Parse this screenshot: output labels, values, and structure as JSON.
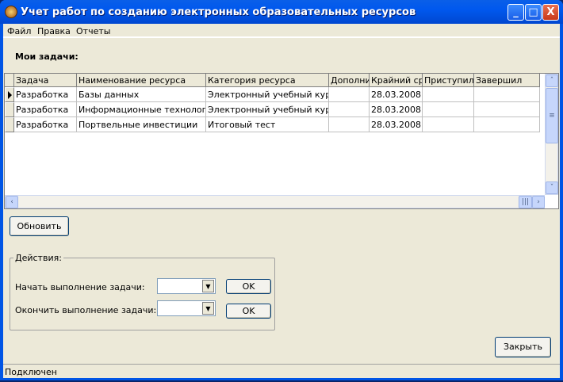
{
  "window": {
    "title": "Учет работ по созданию электронных образовательных ресурсов",
    "minimize": "_",
    "maximize": "□",
    "close": "X"
  },
  "menu": [
    "Файл",
    "Правка",
    "Отчеты"
  ],
  "section_title": "Мои задачи:",
  "table": {
    "columns": [
      "Задача",
      "Наименование ресурса",
      "Категория ресурса",
      "Дополнит",
      "Крайний сро",
      "Приступил",
      "Завершил"
    ],
    "rows": [
      [
        "Разработка",
        "Базы данных",
        "Электронный учебный курс",
        "",
        "28.03.2008",
        "",
        ""
      ],
      [
        "Разработка",
        "Информационные технологии",
        "Электронный учебный курс",
        "",
        "28.03.2008",
        "",
        ""
      ],
      [
        "Разработка",
        "Портвельные инвестиции",
        "Итоговый тест",
        "",
        "28.03.2008",
        "",
        ""
      ]
    ],
    "current_row": 0
  },
  "refresh_button": "Обновить",
  "actions": {
    "legend": "Действия:",
    "start_label": "Начать выполнение задачи:",
    "finish_label": "Окончить выполнение задачи:",
    "start_value": "",
    "finish_value": "",
    "ok": "OK"
  },
  "close_button": "Закрыть",
  "status": "Подключен"
}
